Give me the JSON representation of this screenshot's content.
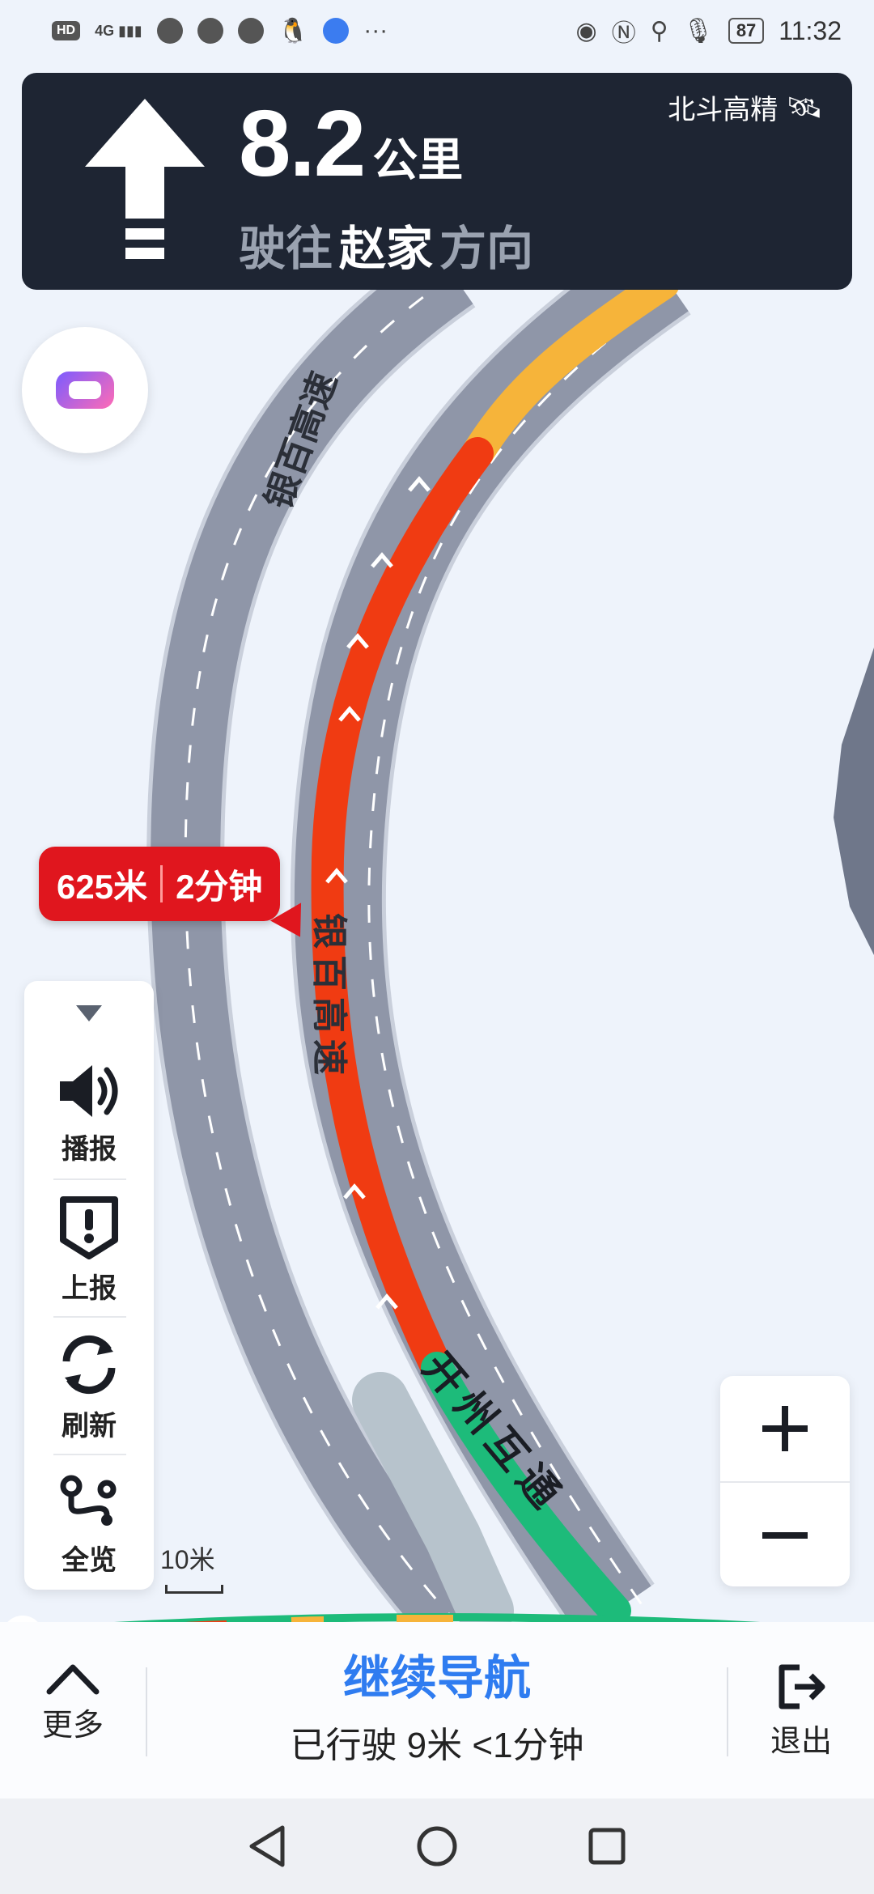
{
  "status_bar": {
    "hd": "HD",
    "network": "4G",
    "ellipsis": "···",
    "battery": "87",
    "time": "11:32"
  },
  "guidance": {
    "distance_value": "8.2",
    "distance_unit": "公里",
    "direction_prefix": "驶往",
    "direction_road": "赵家",
    "direction_suffix": "方向",
    "positioning_label": "北斗高精"
  },
  "map": {
    "road_label_left": "银百高速",
    "road_label_route": "银百高速",
    "road_label_interchange": "开州互通",
    "traffic_colors": {
      "jam": "#f03b12",
      "slow": "#f6b43a",
      "clear": "#1dbb7a",
      "road": "#8f96a8"
    }
  },
  "bubble": {
    "distance": "625米",
    "time": "2分钟"
  },
  "tools": {
    "broadcast": "播报",
    "report": "上报",
    "refresh": "刷新",
    "overview": "全览"
  },
  "scale": {
    "label": "10米"
  },
  "bottom_bar": {
    "more": "更多",
    "continue_title": "继续导航",
    "traveled": "已行驶 9米 <1分钟",
    "exit": "退出"
  }
}
